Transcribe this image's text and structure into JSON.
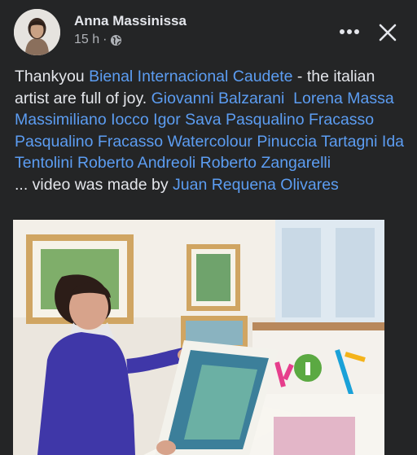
{
  "post": {
    "author": "Anna Massinissa",
    "time": "15 h",
    "separator": "·",
    "more_icon": "more-options-icon",
    "close_icon": "close-icon",
    "text": {
      "seg1": "Thankyou ",
      "link1": "Bienal Internacional Caudete",
      "seg2": " - the italian artist are full of joy. ",
      "names": [
        "Giovanni Balzarani",
        "Lorena Massa",
        "Massimiliano Iocco",
        "Igor Sava",
        "Pasqualino Fracasso",
        "Pasqualino Fracasso Watercolour",
        "Pinuccia Tartagni",
        "Ida Tentolini",
        "Roberto Andreoli",
        "Roberto Zangarelli"
      ],
      "seg3": "... video was made by ",
      "link_last": "Juan Requena Olivares"
    }
  },
  "colors": {
    "background": "#242526",
    "text": "#e4e6eb",
    "secondary_text": "#b0b3b8",
    "link": "#5c9df2"
  }
}
